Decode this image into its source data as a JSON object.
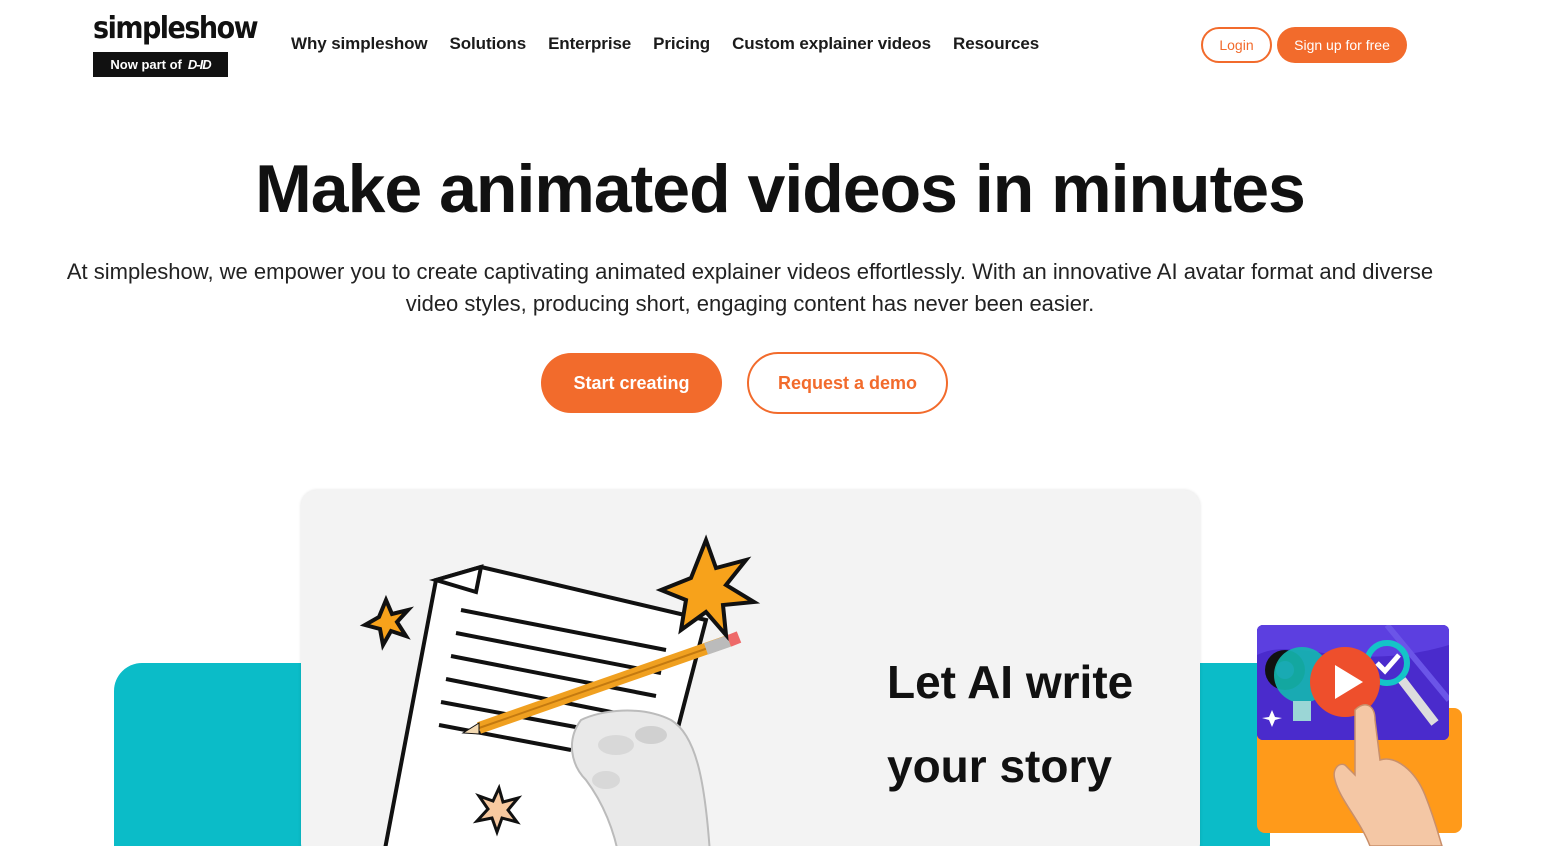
{
  "brand": {
    "name": "simpleshow",
    "badge_prefix": "Now part of",
    "badge_partner": "D-ID"
  },
  "nav": {
    "items": [
      {
        "label": "Why simpleshow"
      },
      {
        "label": "Solutions"
      },
      {
        "label": "Enterprise"
      },
      {
        "label": "Pricing"
      },
      {
        "label": "Custom explainer videos"
      },
      {
        "label": "Resources"
      }
    ],
    "login_label": "Login",
    "signup_label": "Sign up for free"
  },
  "hero": {
    "title": "Make animated videos in minutes",
    "subtitle": "At simpleshow, we empower you to create captivating animated explainer videos effortlessly. With an innovative AI avatar format and diverse video styles, producing short, engaging content has never been easier.",
    "primary_cta": "Start creating",
    "secondary_cta": "Request a demo"
  },
  "showcase": {
    "card_line1": "Let AI write",
    "card_line2": "your story"
  },
  "colors": {
    "accent": "#f26b2c",
    "teal": "#0bbcc8",
    "orange": "#ff9a1a",
    "purple": "#4a2bcc",
    "star": "#f7a21b"
  }
}
